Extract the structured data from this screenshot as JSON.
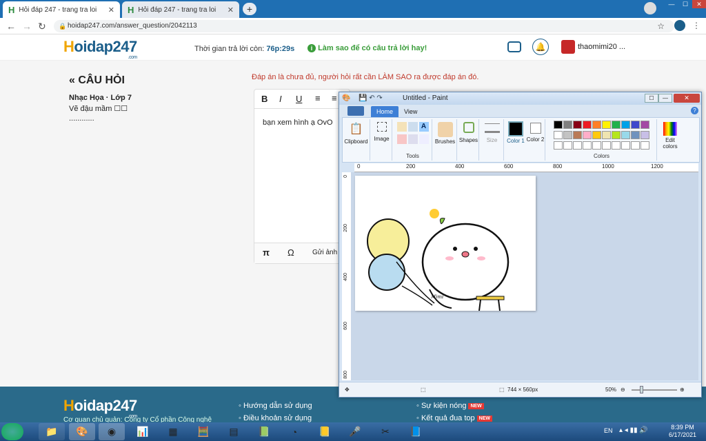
{
  "browser": {
    "tabs": [
      {
        "title": "Hỏi đáp 247 - trang tra loi",
        "close": "✕"
      },
      {
        "title": "Hỏi đáp 247 - trang tra loi",
        "close": "✕"
      }
    ],
    "new_tab": "+",
    "url": "hoidap247.com/answer_question/2042113"
  },
  "site": {
    "logo_h": "H",
    "logo_rest": "oidap247",
    "logo_com": ".com",
    "timer_label": "Thời gian trả lời còn:",
    "timer_value": "76p:29s",
    "tip": "Làm sao để có câu trả lời hay!",
    "username": "thaomimi20 ..."
  },
  "question": {
    "heading": "CÂU HỎI",
    "subject": "Nhạc Họa · Lớp 7",
    "text": "Vẽ đậu mầm ☐☐",
    "dots": "............"
  },
  "answer": {
    "warning": "Đáp án là chưa đủ, người hỏi rất cần LÀM SAO ra được đáp án đó.",
    "content": "bạn xem hình ạ OvO",
    "insert_image": "Gửi ảnh"
  },
  "footer": {
    "logo_h": "H",
    "logo_rest": "oidap247",
    "logo_com": ".com",
    "org": "Cơ quan chủ quản: Công ty Cổ phần Công nghệ",
    "links_left": [
      "Hướng dẫn sử dụng",
      "Điều khoản sử dụng"
    ],
    "links_right": [
      "Sự kiện nóng",
      "Kết quả đua top"
    ],
    "new_badge": "NEW"
  },
  "paint": {
    "title": "Untitled - Paint",
    "tab_home": "Home",
    "tab_view": "View",
    "groups": {
      "clipboard": "Clipboard",
      "image": "Image",
      "tools": "Tools",
      "brushes": "Brushes",
      "shapes": "Shapes",
      "size": "Size",
      "color1": "Color 1",
      "color2": "Color 2",
      "colors": "Colors",
      "edit_colors": "Edit colors"
    },
    "ruler_ticks": [
      "0",
      "200",
      "400",
      "600",
      "800",
      "1000",
      "1200"
    ],
    "vruler_ticks": [
      "0",
      "200",
      "400",
      "600",
      "800"
    ],
    "canvas_size": "744 × 560px",
    "zoom": "50%",
    "palette_row1": [
      "#000000",
      "#7f7f7f",
      "#880015",
      "#ed1c24",
      "#ff7f27",
      "#fff200",
      "#22b14c",
      "#00a2e8",
      "#3f48cc",
      "#a349a4"
    ],
    "palette_row2": [
      "#ffffff",
      "#c3c3c3",
      "#b97a57",
      "#ffaec9",
      "#ffc90e",
      "#efe4b0",
      "#b5e61d",
      "#99d9ea",
      "#7092be",
      "#c8bfe7"
    ],
    "palette_row3": [
      "#ffffff",
      "#ffffff",
      "#ffffff",
      "#ffffff",
      "#ffffff",
      "#ffffff",
      "#ffffff",
      "#ffffff",
      "#ffffff",
      "#ffffff"
    ],
    "signature": "Mimi"
  },
  "taskbar": {
    "lang": "EN",
    "time": "8:39 PM",
    "date": "6/17/2021"
  }
}
